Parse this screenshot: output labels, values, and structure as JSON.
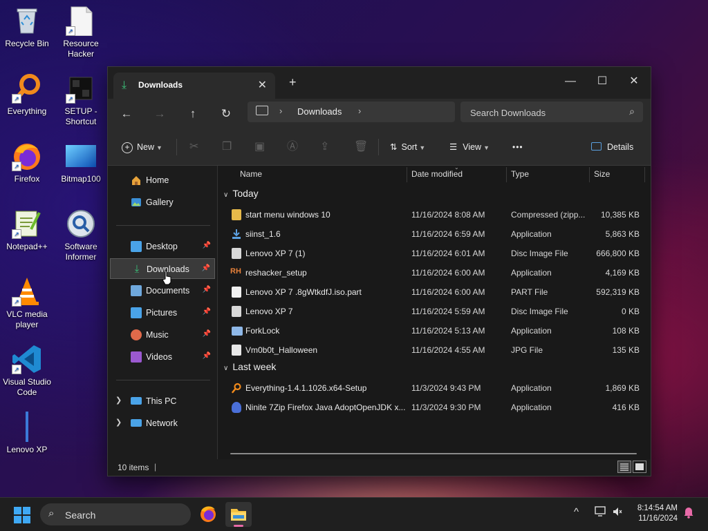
{
  "desktop": {
    "icons": [
      {
        "label": "Recycle Bin",
        "icon": "recycle-bin-icon"
      },
      {
        "label": "Resource Hacker",
        "icon": "resource-hacker-icon"
      },
      {
        "label": "Everything",
        "icon": "everything-icon"
      },
      {
        "label": "SETUP - Shortcut",
        "icon": "setup-shortcut-icon"
      },
      {
        "label": "Firefox",
        "icon": "firefox-icon"
      },
      {
        "label": "Bitmap100",
        "icon": "bitmap-icon"
      },
      {
        "label": "Notepad++",
        "icon": "notepadpp-icon"
      },
      {
        "label": "Software Informer",
        "icon": "software-informer-icon"
      },
      {
        "label": "VLC media player",
        "icon": "vlc-icon"
      },
      {
        "label": "Visual Studio Code",
        "icon": "vscode-icon"
      },
      {
        "label": "Lenovo XP",
        "icon": "lenovo-xp-icon"
      }
    ]
  },
  "window": {
    "tab_title": "Downloads",
    "tab_close": "✕",
    "new_tab": "+",
    "controls": {
      "minimize": "—",
      "maximize": "☐",
      "close": "✕"
    },
    "nav": {
      "back": "←",
      "forward": "→",
      "up": "↑",
      "refresh": "↻"
    },
    "breadcrumb": [
      "Downloads"
    ],
    "search_placeholder": "Search Downloads",
    "toolbar": {
      "new_label": "New",
      "sort_label": "Sort",
      "view_label": "View",
      "more_label": "•••",
      "details_label": "Details"
    },
    "sidebar": {
      "top": [
        {
          "label": "Home",
          "icon": "home-icon",
          "color": "#e8a33a"
        },
        {
          "label": "Gallery",
          "icon": "gallery-icon",
          "color": "#3b8fd6"
        }
      ],
      "quick": [
        {
          "label": "Desktop",
          "icon": "desktop-icon",
          "color": "#4aa3e8",
          "pinned": true
        },
        {
          "label": "Downloads",
          "icon": "downloads-icon",
          "color": "#3bc27a",
          "pinned": true,
          "selected": true
        },
        {
          "label": "Documents",
          "icon": "documents-icon",
          "color": "#6fa8dc",
          "pinned": true
        },
        {
          "label": "Pictures",
          "icon": "pictures-icon",
          "color": "#4aa3e8",
          "pinned": true
        },
        {
          "label": "Music",
          "icon": "music-icon",
          "color": "#e06a4a",
          "pinned": true
        },
        {
          "label": "Videos",
          "icon": "videos-icon",
          "color": "#9b59d0",
          "pinned": true
        }
      ],
      "tree": [
        {
          "label": "This PC",
          "icon": "this-pc-icon",
          "color": "#4aa3e8"
        },
        {
          "label": "Network",
          "icon": "network-icon",
          "color": "#4aa3e8"
        }
      ]
    },
    "columns": {
      "name": "Name",
      "date": "Date modified",
      "type": "Type",
      "size": "Size"
    },
    "groups": [
      {
        "label": "Today",
        "files": [
          {
            "name": "start menu windows 10",
            "date": "11/16/2024 8:08 AM",
            "type": "Compressed (zipp...",
            "size": "10,385 KB",
            "icon": "zip-folder-icon",
            "color": "#e6b94a"
          },
          {
            "name": "siinst_1.6",
            "date": "11/16/2024 6:59 AM",
            "type": "Application",
            "size": "5,863 KB",
            "icon": "installer-icon",
            "color": "#5ba0e0"
          },
          {
            "name": "Lenovo XP 7 (1)",
            "date": "11/16/2024 6:01 AM",
            "type": "Disc Image File",
            "size": "666,800 KB",
            "icon": "disc-image-icon",
            "color": "#d8d8d8"
          },
          {
            "name": "reshacker_setup",
            "date": "11/16/2024 6:00 AM",
            "type": "Application",
            "size": "4,169 KB",
            "icon": "reshacker-icon",
            "color": "#e8813a"
          },
          {
            "name": "Lenovo XP 7 .8gWtkdfJ.iso.part",
            "date": "11/16/2024 6:00 AM",
            "type": "PART File",
            "size": "592,319 KB",
            "icon": "file-icon",
            "color": "#f0f0f0"
          },
          {
            "name": "Lenovo XP 7",
            "date": "11/16/2024 5:59 AM",
            "type": "Disc Image File",
            "size": "0 KB",
            "icon": "disc-image-icon",
            "color": "#d8d8d8"
          },
          {
            "name": "ForkLock",
            "date": "11/16/2024 5:13 AM",
            "type": "Application",
            "size": "108 KB",
            "icon": "app-window-icon",
            "color": "#8fb8e8"
          },
          {
            "name": "Vm0b0t_Halloween",
            "date": "11/16/2024 4:55 AM",
            "type": "JPG File",
            "size": "135 KB",
            "icon": "image-file-icon",
            "color": "#e8e8e8"
          }
        ]
      },
      {
        "label": "Last week",
        "files": [
          {
            "name": "Everything-1.4.1.1026.x64-Setup",
            "date": "11/3/2024 9:43 PM",
            "type": "Application",
            "size": "1,869 KB",
            "icon": "everything-setup-icon",
            "color": "#f08a1c"
          },
          {
            "name": "Ninite 7Zip Firefox Java AdoptOpenJDK x...",
            "date": "11/3/2024 9:30 PM",
            "type": "Application",
            "size": "416 KB",
            "icon": "ninite-icon",
            "color": "#4a6fd8"
          }
        ]
      }
    ],
    "status": {
      "items": "10 items",
      "separator": "|"
    }
  },
  "taskbar": {
    "search_placeholder": "Search",
    "time": "8:14:54 AM",
    "date": "11/16/2024",
    "tray": {
      "chevron": "^"
    }
  },
  "colors": {
    "accent": "#3bc27a",
    "window_bg": "#1c1c1c",
    "toolbar_bg": "#2b2b2b"
  }
}
